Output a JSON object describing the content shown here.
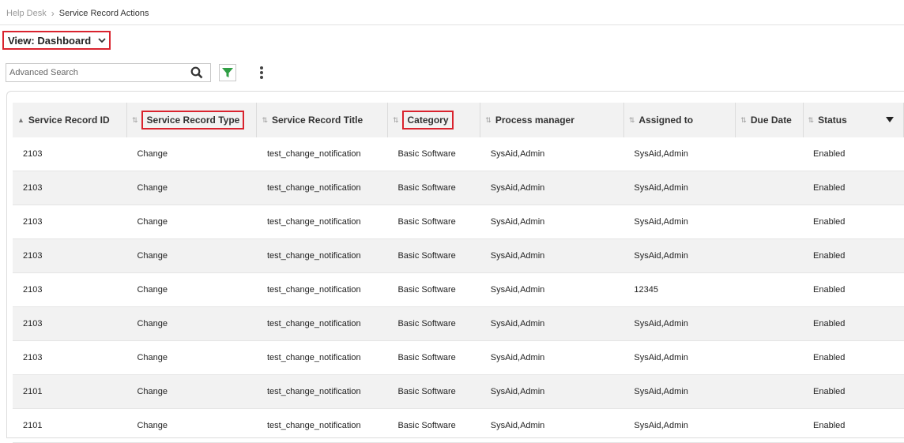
{
  "breadcrumb": {
    "root": "Help Desk",
    "current": "Service Record Actions"
  },
  "view": {
    "label": "View: Dashboard"
  },
  "search": {
    "placeholder": "Advanced Search"
  },
  "table": {
    "columns": [
      {
        "label": "Service Record ID",
        "sort": "asc"
      },
      {
        "label": "Service Record Type",
        "sort": "none",
        "highlighted": true
      },
      {
        "label": "Service Record Title",
        "sort": "none"
      },
      {
        "label": "Category",
        "sort": "none",
        "highlighted": true
      },
      {
        "label": "Process manager",
        "sort": "none"
      },
      {
        "label": "Assigned to",
        "sort": "none"
      },
      {
        "label": "Due Date",
        "sort": "none"
      },
      {
        "label": "Status",
        "sort": "none"
      }
    ],
    "rows": [
      [
        "2103",
        "Change",
        "test_change_notification",
        "Basic Software",
        "SysAid,Admin",
        "SysAid,Admin",
        "",
        "Enabled"
      ],
      [
        "2103",
        "Change",
        "test_change_notification",
        "Basic Software",
        "SysAid,Admin",
        "SysAid,Admin",
        "",
        "Enabled"
      ],
      [
        "2103",
        "Change",
        "test_change_notification",
        "Basic Software",
        "SysAid,Admin",
        "SysAid,Admin",
        "",
        "Enabled"
      ],
      [
        "2103",
        "Change",
        "test_change_notification",
        "Basic Software",
        "SysAid,Admin",
        "SysAid,Admin",
        "",
        "Enabled"
      ],
      [
        "2103",
        "Change",
        "test_change_notification",
        "Basic Software",
        "SysAid,Admin",
        "12345",
        "",
        "Enabled"
      ],
      [
        "2103",
        "Change",
        "test_change_notification",
        "Basic Software",
        "SysAid,Admin",
        "SysAid,Admin",
        "",
        "Enabled"
      ],
      [
        "2103",
        "Change",
        "test_change_notification",
        "Basic Software",
        "SysAid,Admin",
        "SysAid,Admin",
        "",
        "Enabled"
      ],
      [
        "2101",
        "Change",
        "test_change_notification",
        "Basic Software",
        "SysAid,Admin",
        "SysAid,Admin",
        "",
        "Enabled"
      ],
      [
        "2101",
        "Change",
        "test_change_notification",
        "Basic Software",
        "SysAid,Admin",
        "SysAid,Admin",
        "",
        "Enabled"
      ]
    ]
  },
  "colors": {
    "highlight": "#d9232e",
    "filter": "#2f9e44",
    "header_bg": "#f2f2f2"
  },
  "icons": {
    "search": "search-icon",
    "filter": "filter-icon",
    "more": "more-vertical-icon",
    "view_dropdown": "chevron-down-icon"
  }
}
